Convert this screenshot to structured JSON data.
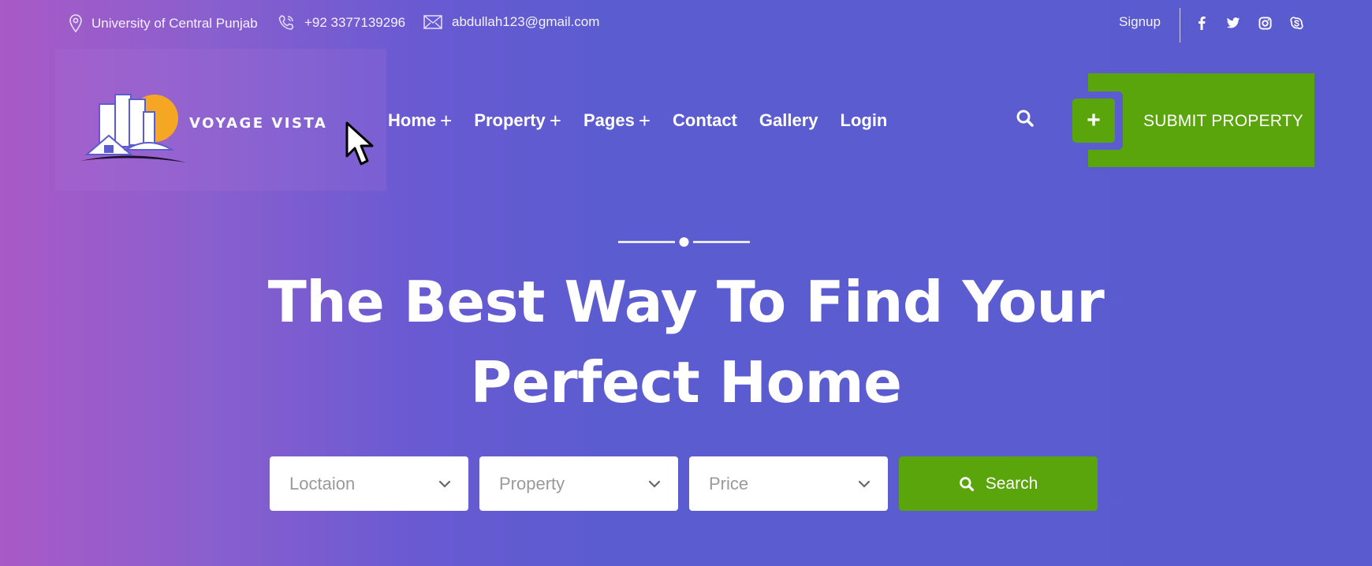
{
  "topbar": {
    "location": "University of Central Punjab",
    "phone": "+92 3377139296",
    "email": "abdullah123@gmail.com",
    "signup": "Signup",
    "social": [
      "facebook-icon",
      "twitter-icon",
      "instagram-icon",
      "skype-icon"
    ]
  },
  "header": {
    "brand": "VOYAGE VISTA",
    "nav": [
      {
        "label": "Home",
        "has_plus": true
      },
      {
        "label": "Property",
        "has_plus": true
      },
      {
        "label": "Pages",
        "has_plus": true
      },
      {
        "label": "Contact",
        "has_plus": false
      },
      {
        "label": "Gallery",
        "has_plus": false
      },
      {
        "label": "Login",
        "has_plus": false
      }
    ],
    "submit_plus": "+",
    "submit_label": "SUBMIT PROPERTY"
  },
  "hero": {
    "title_line1": "The Best Way To Find Your",
    "title_line2": "Perfect Home"
  },
  "search": {
    "location_placeholder": "Loctaion",
    "property_placeholder": "Property",
    "price_placeholder": "Price",
    "button_label": "Search"
  },
  "colors": {
    "accent_green": "#5aa50b",
    "bg_purple": "#5a5ccf",
    "bg_magenta": "#a85ac6",
    "logo_sun": "#f5a623"
  }
}
